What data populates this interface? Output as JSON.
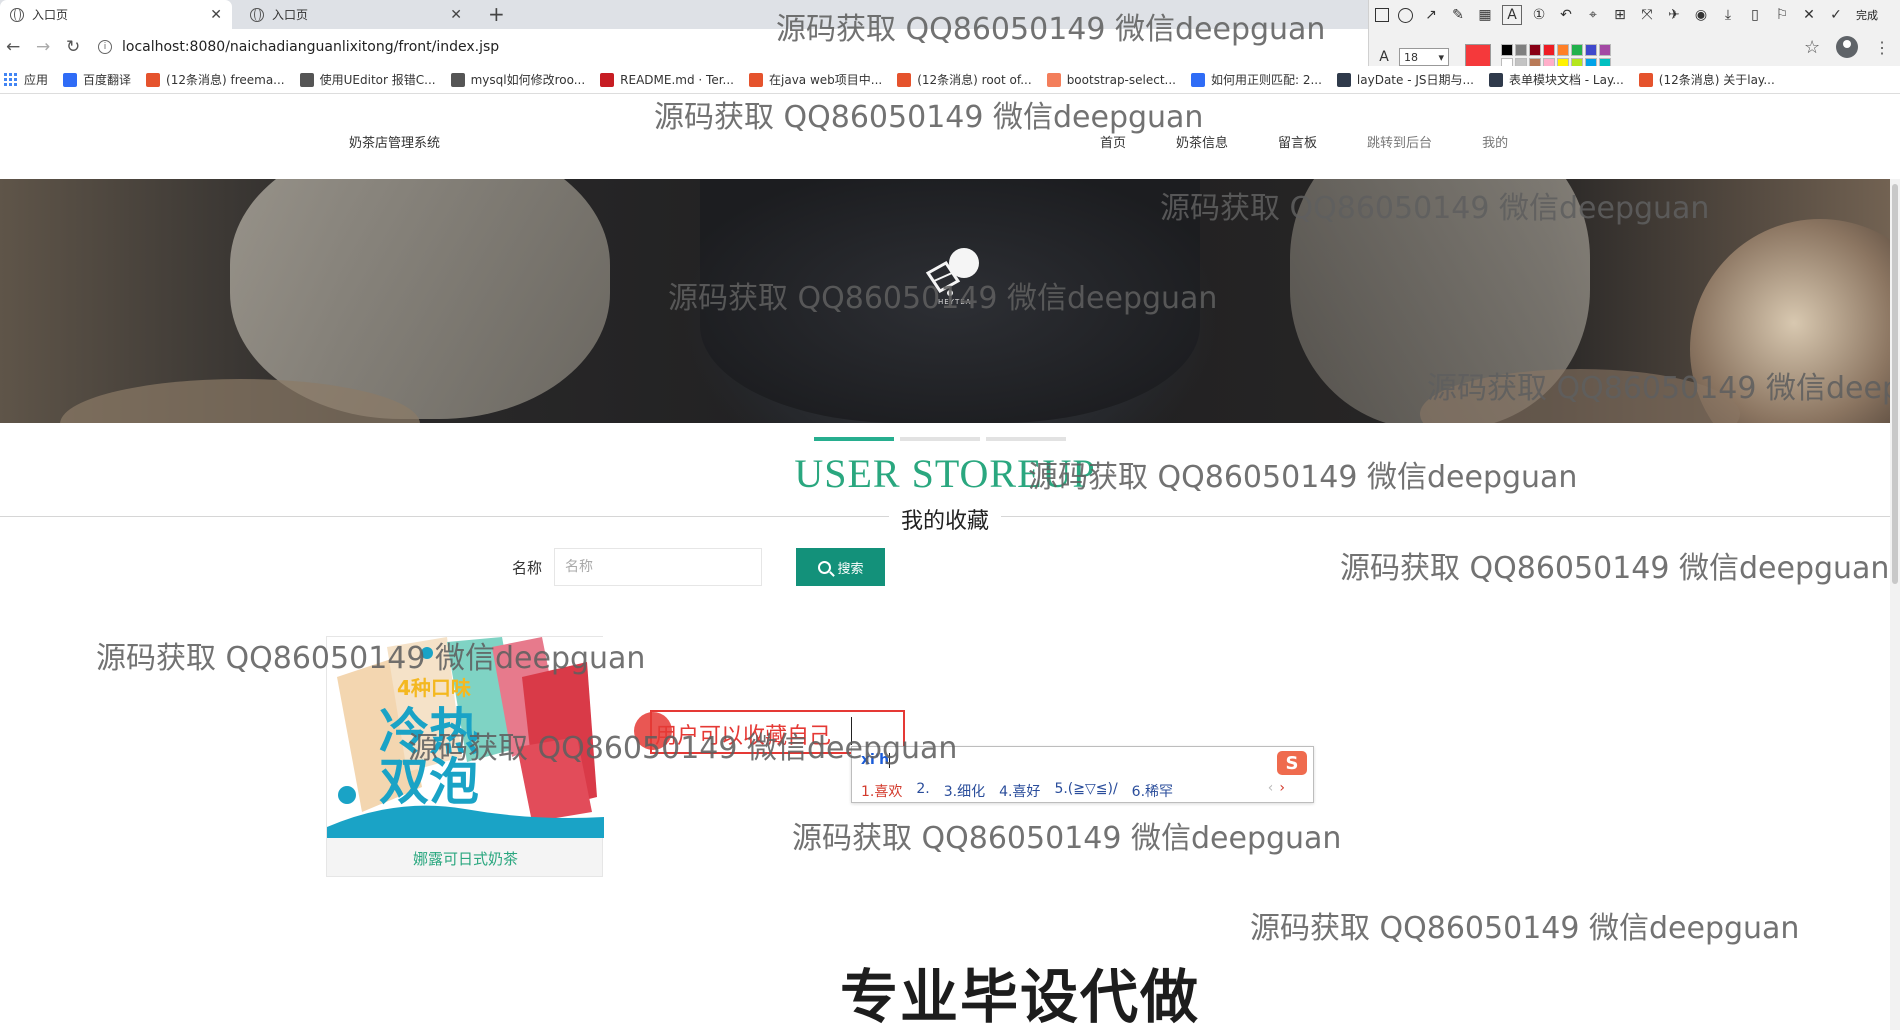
{
  "browser": {
    "tabs": [
      {
        "title": "入口页",
        "active": true
      },
      {
        "title": "入口页",
        "active": false
      }
    ],
    "url": "localhost:8080/naichadianguanlixitong/front/index.jsp",
    "bookmarks": [
      {
        "label": "应用",
        "icon": "apps-grid-icon",
        "color": "#4285f4"
      },
      {
        "label": "百度翻译",
        "icon": "baidu-translate-icon",
        "color": "#2f6cf6"
      },
      {
        "label": "(12条消息) freema...",
        "icon": "csdn-icon",
        "color": "#e5532d"
      },
      {
        "label": "使用UEditor 报错C...",
        "icon": "cnblogs-icon",
        "color": "#555555"
      },
      {
        "label": "mysql如何修改roo...",
        "icon": "cnblogs-icon",
        "color": "#555555"
      },
      {
        "label": "README.md · Ter...",
        "icon": "gitee-icon",
        "color": "#c71d23"
      },
      {
        "label": "在java web项目中...",
        "icon": "csdn-icon",
        "color": "#e5532d"
      },
      {
        "label": "(12条消息) root of...",
        "icon": "csdn-icon",
        "color": "#e5532d"
      },
      {
        "label": "bootstrap-select...",
        "icon": "bootstrap-icon",
        "color": "#f37e5b"
      },
      {
        "label": "如何用正则匹配: 2...",
        "icon": "baidu-paw-icon",
        "color": "#2f6cf6"
      },
      {
        "label": "layDate - JS日期与...",
        "icon": "layui-icon",
        "color": "#2f3a4b"
      },
      {
        "label": "表单模块文档 - Lay...",
        "icon": "layui-icon",
        "color": "#2f3a4b"
      },
      {
        "label": "(12条消息) 关于lay...",
        "icon": "csdn-icon",
        "color": "#e5532d"
      }
    ]
  },
  "annotation_toolbar": {
    "done_label": "完成",
    "font_size": "18",
    "current_color": "#f5393b",
    "palette": [
      "#000000",
      "#7f7f7f",
      "#880015",
      "#ed1c24",
      "#ff7f27",
      "#22b14c",
      "#3f48cc",
      "#a349a4",
      "#ffffff",
      "#c3c3c3",
      "#b97a57",
      "#ffaec9",
      "#fff200",
      "#b5e61d",
      "#00a2e8",
      "#00c0c0"
    ]
  },
  "site": {
    "name": "奶茶店管理系统",
    "nav": [
      {
        "label": "首页",
        "muted": false
      },
      {
        "label": "奶茶信息",
        "muted": false
      },
      {
        "label": "留言板",
        "muted": false
      },
      {
        "label": "跳转到后台",
        "muted": true
      },
      {
        "label": "我的",
        "muted": true
      }
    ],
    "banner_brand": "HEYTEA",
    "accent_color": "#2aa77f",
    "button_color": "#13917a"
  },
  "section": {
    "title": "USER STOREUP",
    "subtitle": "我的收藏"
  },
  "search": {
    "label": "名称",
    "placeholder": "名称",
    "button_label": "搜索"
  },
  "favorites": [
    {
      "name": "娜露可日式奶茶",
      "image_text": "4种口味 冷热 双泡"
    }
  ],
  "screen_annotation": {
    "text": "用户可以收藏自己"
  },
  "ime": {
    "input": "xi'h",
    "candidates": [
      "1.喜欢",
      "2.",
      "3.细化",
      "4.喜好",
      "5.(≧▽≦)/",
      "6.稀罕"
    ]
  },
  "watermarks": [
    "源码获取 QQ86050149 微信deepguan",
    "源码获取 QQ86050149 微信deepguan",
    "源码获取 QQ86050149 微信deepguan",
    "源码获取 QQ86050149 微信deepguan",
    "源码获取 QQ86050149 微信deepguan",
    "源码获取 QQ86050149 微信deepguan",
    "源码获取 QQ86050149 微信deepguan",
    "源码获取 QQ86050149 微信deepguan",
    "源码获取 QQ86050149 微信deepguan",
    "源码获取 QQ86050149 微信deepguan",
    "源码获取 QQ86050149 微信deepguan"
  ],
  "promo_text": "专业毕设代做"
}
